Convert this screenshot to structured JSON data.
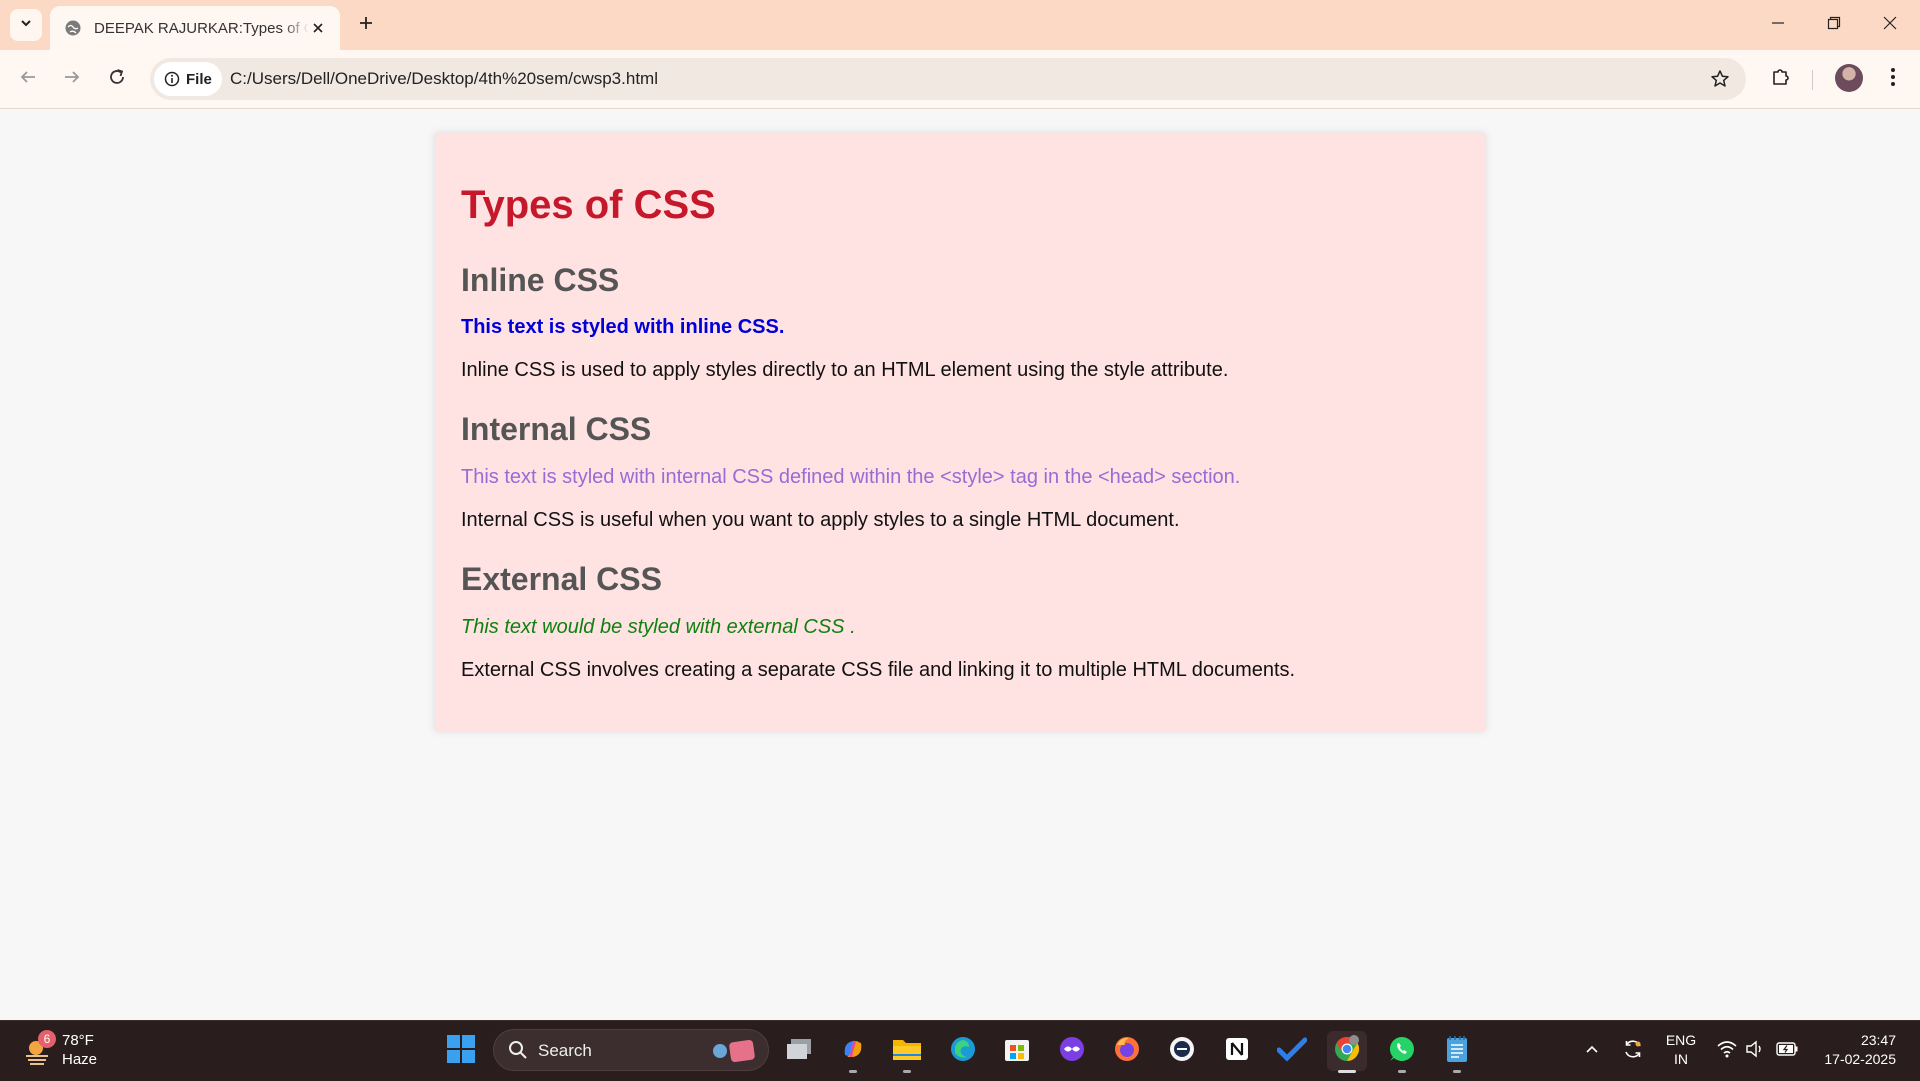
{
  "browser": {
    "tab_title": "DEEPAK RAJURKAR:Types of CSS",
    "site_chip_label": "File",
    "url": "C:/Users/Dell/OneDrive/Desktop/4th%20sem/cwsp3.html"
  },
  "page": {
    "title": "Types of CSS",
    "sections": [
      {
        "heading": "Inline CSS",
        "demo": "This text is styled with inline CSS.",
        "desc": "Inline CSS is used to apply styles directly to an HTML element using the style attribute."
      },
      {
        "heading": "Internal CSS",
        "demo": "This text is styled with internal CSS defined within the <style> tag in the <head> section.",
        "desc": "Internal CSS is useful when you want to apply styles to a single HTML document."
      },
      {
        "heading": "External CSS",
        "demo": "This text would be styled with external CSS .",
        "desc": "External CSS involves creating a separate CSS file and linking it to multiple HTML documents."
      }
    ],
    "colors": {
      "title": "#c5192b",
      "heading": "#555555",
      "inline_demo": "#0000d6",
      "internal_demo": "#9a6ad6",
      "external_demo": "#108010",
      "card_background": "#ffe2e2"
    }
  },
  "taskbar": {
    "weather": {
      "badge": "6",
      "temp": "78°F",
      "condition": "Haze"
    },
    "search_label": "Search",
    "pinned_icons": [
      "task-view-icon",
      "copilot-icon",
      "file-explorer-icon",
      "edge-icon",
      "microsoft-store-icon",
      "app-icon",
      "firefox-icon",
      "nxtwave-icon",
      "notion-icon",
      "todo-icon",
      "chrome-icon",
      "whatsapp-icon",
      "notepad-icon"
    ],
    "tray": {
      "lang_line1": "ENG",
      "lang_line2": "IN",
      "time": "23:47",
      "date": "17-02-2025"
    }
  }
}
